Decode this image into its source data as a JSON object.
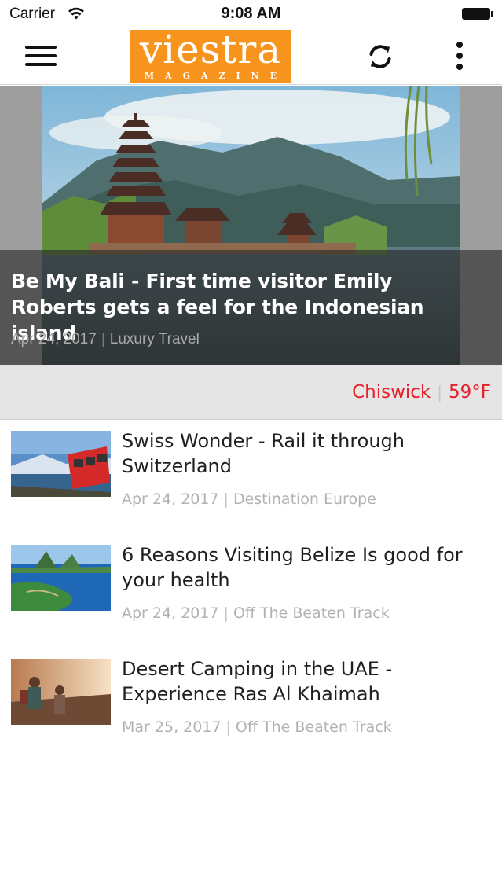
{
  "status_bar": {
    "carrier": "Carrier",
    "time": "9:08 AM"
  },
  "nav": {
    "logo_word": "viestra",
    "logo_sub": "MAGAZINE",
    "logo_color": "#f7941e",
    "icons": [
      "menu-icon",
      "refresh-icon",
      "more-vertical-icon"
    ]
  },
  "hero": {
    "title": "Be My Bali - First time visitor Emily Roberts gets a feel for the Indonesian island",
    "date": "Apr 24, 2017",
    "category": "Luxury Travel",
    "separator": "|"
  },
  "weather": {
    "location": "Chiswick",
    "temperature": "59°F",
    "separator": "|",
    "color": "#e8202a"
  },
  "articles": [
    {
      "title": "Swiss Wonder - Rail it through Switzerland",
      "date": "Apr 24, 2017",
      "category": "Destination Europe",
      "separator": "|"
    },
    {
      "title": "6 Reasons Visiting Belize Is good for your health",
      "date": "Apr 24, 2017",
      "category": "Off The Beaten Track",
      "separator": "|"
    },
    {
      "title": "Desert Camping in the UAE - Experience Ras Al Khaimah",
      "date": "Mar 25, 2017",
      "category": "Off The Beaten Track",
      "separator": "|"
    }
  ]
}
